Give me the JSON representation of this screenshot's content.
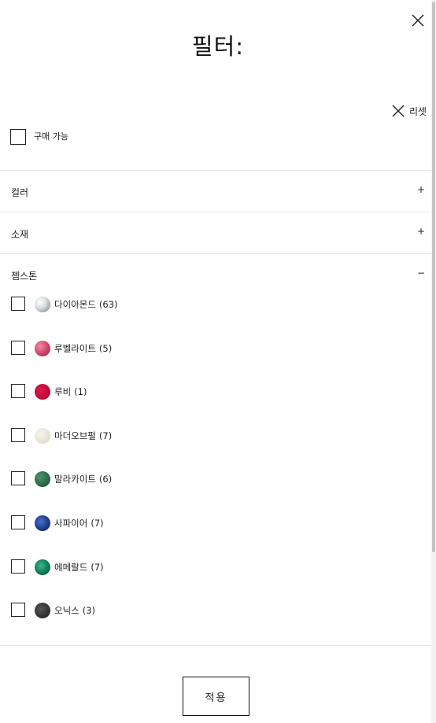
{
  "filter": {
    "title": "필터:",
    "reset_label": "리셋",
    "availability_label": "구매 가능",
    "apply_label": "적용",
    "sections": {
      "color": {
        "label": "컬러",
        "toggle": "+"
      },
      "material": {
        "label": "소재",
        "toggle": "+"
      },
      "gemstone": {
        "label": "젬스톤",
        "toggle": "−"
      }
    },
    "gemstones": [
      {
        "name": "다이아몬드",
        "count": "(63)",
        "color": "#b9c1c4"
      },
      {
        "name": "루벨라이트",
        "count": "(5)",
        "color": "#d2496e"
      },
      {
        "name": "루비",
        "count": "(1)",
        "color": "#c20a3a"
      },
      {
        "name": "마더오브펄",
        "count": "(7)",
        "color": "#e6e2d6"
      },
      {
        "name": "말라카이트",
        "count": "(6)",
        "color": "#2f6a4a"
      },
      {
        "name": "사파이어",
        "count": "(7)",
        "color": "#1e3c8c"
      },
      {
        "name": "에메랄드",
        "count": "(7)",
        "color": "#0f7a5a"
      },
      {
        "name": "오닉스",
        "count": "(3)",
        "color": "#333333"
      }
    ]
  }
}
